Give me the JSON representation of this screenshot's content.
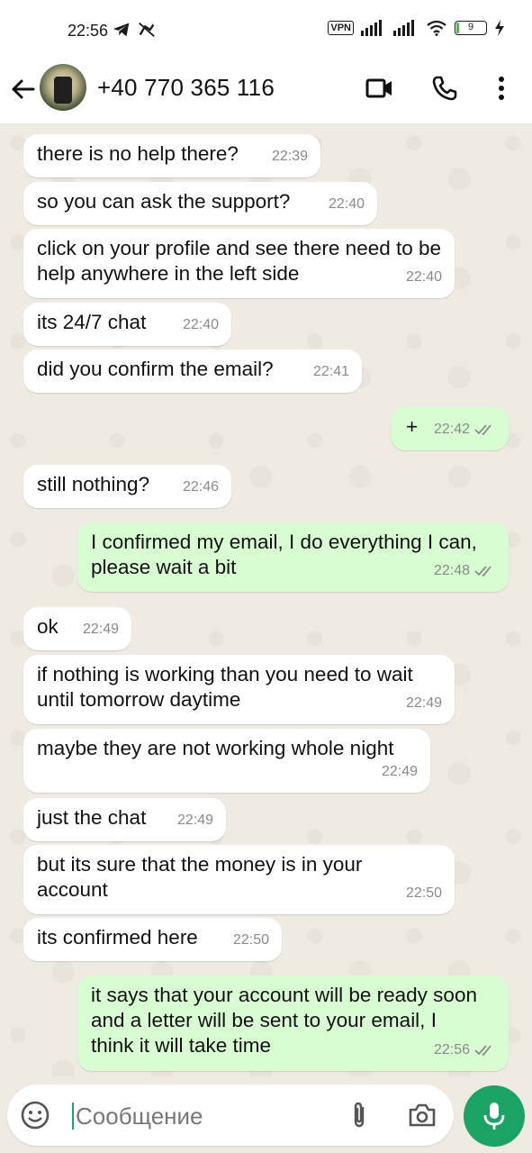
{
  "status_bar": {
    "time": "22:56",
    "vpn": "VPN",
    "battery": "9",
    "battery_level_pct": 9
  },
  "header": {
    "contact": "+40 770 365 116",
    "icons": [
      "back-arrow-icon",
      "video-call-icon",
      "phone-icon",
      "more-vert-icon"
    ]
  },
  "messages": [
    {
      "dir": "in",
      "text": "there is no help there?",
      "time": "22:39"
    },
    {
      "dir": "in",
      "text": "so you can ask the support?",
      "time": "22:40"
    },
    {
      "dir": "in",
      "text": "click on your profile and see there need to be help anywhere in the left side",
      "time": "22:40"
    },
    {
      "dir": "in",
      "text": "its 24/7 chat",
      "time": "22:40"
    },
    {
      "dir": "in",
      "text": "did you confirm the email?",
      "time": "22:41"
    },
    {
      "dir": "out",
      "text": "+",
      "time": "22:42"
    },
    {
      "dir": "in",
      "text": "still nothing?",
      "time": "22:46"
    },
    {
      "dir": "out",
      "text": "I confirmed my email, I do everything I can, please wait a bit",
      "time": "22:48"
    },
    {
      "dir": "in",
      "text": "ok",
      "time": "22:49"
    },
    {
      "dir": "in",
      "text": "if nothing is working than you need to wait until tomorrow daytime",
      "time": "22:49"
    },
    {
      "dir": "in",
      "text": "maybe they are not working whole night",
      "time": "22:49"
    },
    {
      "dir": "in",
      "text": "just the chat",
      "time": "22:49"
    },
    {
      "dir": "in",
      "text": "but its sure that the money is in your account",
      "time": "22:50"
    },
    {
      "dir": "in",
      "text": "its confirmed here",
      "time": "22:50"
    },
    {
      "dir": "out",
      "text": "it says that your account will be ready soon and a letter will be sent to your email, I think it will take time",
      "time": "22:56"
    }
  ],
  "composer": {
    "placeholder": "Сообщение",
    "icons": [
      "emoji-icon",
      "attach-icon",
      "camera-icon",
      "mic-icon"
    ]
  },
  "colors": {
    "incoming_bubble": "#ffffff",
    "outgoing_bubble": "#d9fdd3",
    "chat_background": "#efeae2",
    "accent": "#1aa364",
    "read_ticks": "#8a8a8a"
  }
}
